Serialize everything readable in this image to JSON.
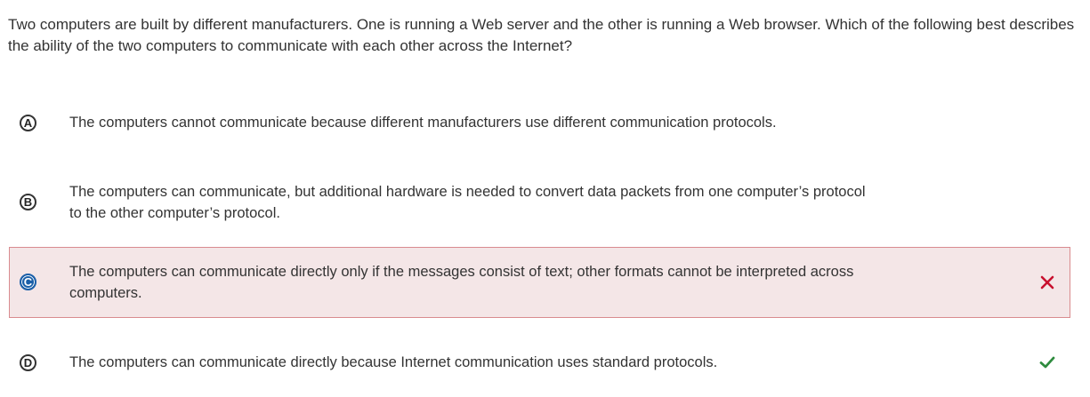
{
  "question": {
    "text": "Two computers are built by different manufacturers. One is running a Web server and the other is running a Web browser. Which of the following best describes the ability of the two computers to communicate with each other across the Internet?"
  },
  "options": [
    {
      "letter": "A",
      "text": "The computers cannot communicate because different manufacturers use different communication protocols.",
      "state": "default"
    },
    {
      "letter": "B",
      "text": "The computers can communicate, but additional hardware is needed to convert data packets from one computer’s protocol to the other computer’s protocol.",
      "state": "default"
    },
    {
      "letter": "C",
      "text": "The computers can communicate directly only if the messages consist of text; other formats cannot be interpreted across computers.",
      "state": "selected-incorrect",
      "mark_icon": "x-icon"
    },
    {
      "letter": "D",
      "text": "The computers can communicate directly because Internet communication uses standard protocols.",
      "state": "correct",
      "mark_icon": "check-icon"
    }
  ],
  "colors": {
    "selected_letter_fill": "#1a5fa8",
    "incorrect_background": "#f4e6e7",
    "incorrect_border": "#d98b8f",
    "incorrect_mark": "#c8102e",
    "correct_mark": "#2e8b3e"
  }
}
